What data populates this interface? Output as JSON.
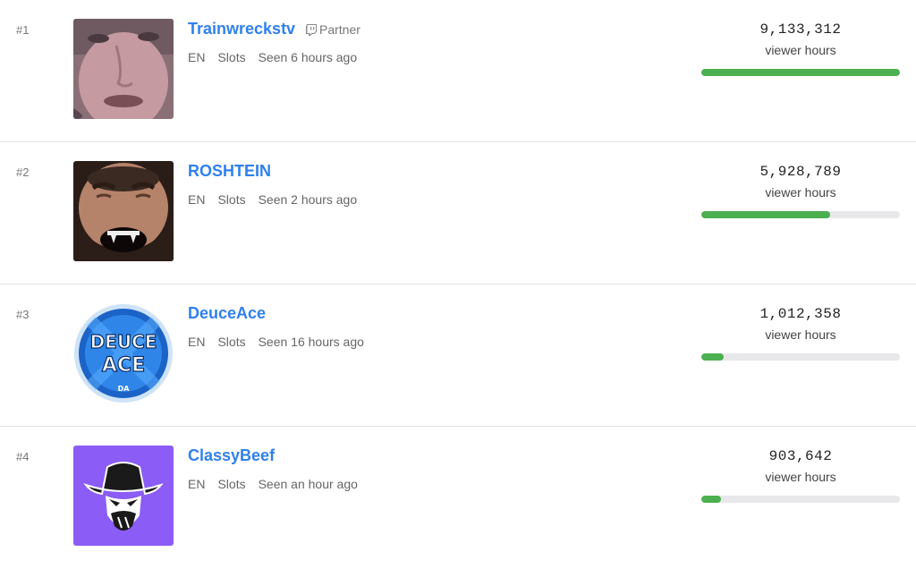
{
  "rows": [
    {
      "rank": "#1",
      "name": "Trainwreckstv",
      "badge": "Partner",
      "badge_icon": "twitch-icon",
      "language": "EN",
      "category": "Slots",
      "seen": "Seen 6 hours ago",
      "viewer_hours": "9,133,312",
      "viewer_hours_label": "viewer hours",
      "progress": 1.0,
      "avatar_icon": "streamer-face-avatar"
    },
    {
      "rank": "#2",
      "name": "ROSHTEIN",
      "language": "EN",
      "category": "Slots",
      "seen": "Seen 2 hours ago",
      "viewer_hours": "5,928,789",
      "viewer_hours_label": "viewer hours",
      "progress": 0.649,
      "avatar_icon": "bearded-man-avatar"
    },
    {
      "rank": "#3",
      "name": "DeuceAce",
      "language": "EN",
      "category": "Slots",
      "seen": "Seen 16 hours ago",
      "viewer_hours": "1,012,358",
      "viewer_hours_label": "viewer hours",
      "progress": 0.111,
      "avatar_icon": "deuce-ace-logo",
      "avatar_text": [
        "DEUCE",
        "ACE",
        "DA"
      ]
    },
    {
      "rank": "#4",
      "name": "ClassyBeef",
      "language": "EN",
      "category": "Slots",
      "seen": "Seen an hour ago",
      "viewer_hours": "903,642",
      "viewer_hours_label": "viewer hours",
      "progress": 0.099,
      "avatar_icon": "cowboy-logo"
    }
  ],
  "colors": {
    "link": "#2f80ed",
    "progress_fill": "#4caf50",
    "progress_track": "#e8e8eb",
    "classybeef_bg": "#8b5cf6",
    "deuceace_blue": "#1e6fd9"
  }
}
